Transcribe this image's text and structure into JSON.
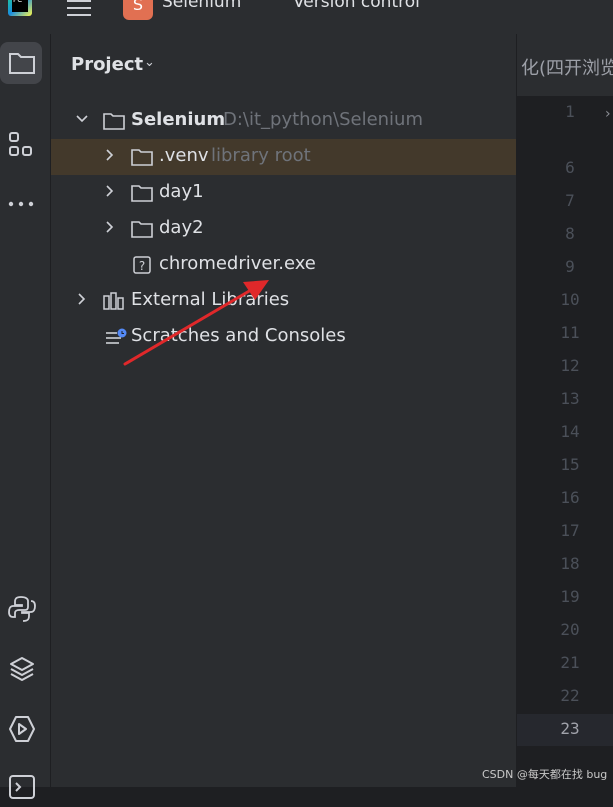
{
  "topbar": {
    "logo_text": "PC",
    "project_badge": "S",
    "project_name": "Selenium",
    "vcs_label": "Version control"
  },
  "panel": {
    "title": "Project"
  },
  "tree": {
    "root": {
      "name": "Selenium",
      "path": "D:\\it_python\\Selenium"
    },
    "venv": {
      "name": ".venv",
      "hint": "library root"
    },
    "day1": {
      "name": "day1"
    },
    "day2": {
      "name": "day2"
    },
    "driver": {
      "name": "chromedriver.exe"
    },
    "external": {
      "name": "External Libraries"
    },
    "scratches": {
      "name": "Scratches and Consoles"
    }
  },
  "editor": {
    "tab_title": "化(四开浏览",
    "line_numbers": [
      "1",
      "6",
      "7",
      "8",
      "9",
      "10",
      "11",
      "12",
      "13",
      "14",
      "15",
      "16",
      "17",
      "18",
      "19",
      "20",
      "21",
      "22",
      "23"
    ],
    "current_line": "23"
  },
  "watermark": "CSDN @每天都在找 bug",
  "colors": {
    "selection": "#43392b",
    "arrow": "#e0282a",
    "badge": "#e17052"
  }
}
